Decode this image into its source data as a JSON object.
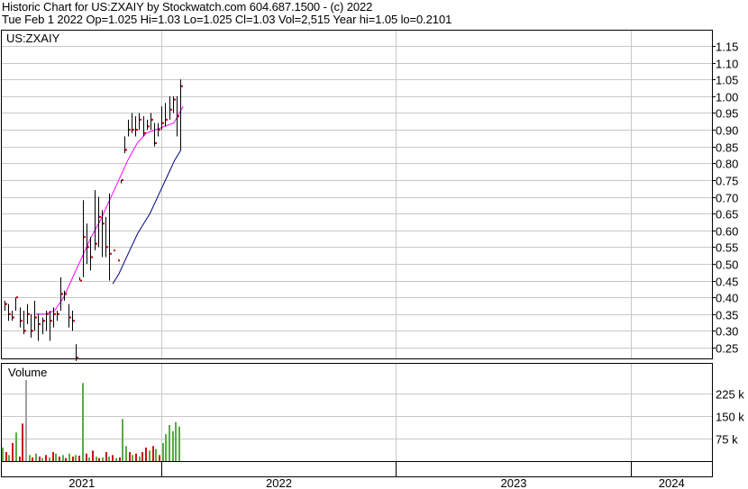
{
  "header": {
    "title": "Historic Chart for US:ZXAIY by Stockwatch.com 604.687.1500 - (c) 2022",
    "quote": "Tue Feb  1 2022  Op=1.025  Hi=1.03  Lo=1.025  Cl=1.03  Vol=2,515  Year hi=1.05  lo=0.2101"
  },
  "chart_data": [
    {
      "type": "ohlc",
      "title": "US:ZXAIY",
      "yticks": [
        "1.15",
        "1.10",
        "1.05",
        "1.00",
        "0.95",
        "0.90",
        "0.85",
        "0.80",
        "0.75",
        "0.70",
        "0.65",
        "0.60",
        "0.55",
        "0.50",
        "0.45",
        "0.40",
        "0.35",
        "0.30",
        "0.25"
      ],
      "ylim": [
        0.2,
        1.18
      ],
      "grid": true,
      "x_axis_labels": [
        "2021",
        "2022",
        "2023",
        "2024"
      ],
      "series": [
        {
          "style": "bars",
          "values": [
            {
              "h": 0.39,
              "l": 0.36,
              "c": 0.38
            },
            {
              "h": 0.38,
              "l": 0.33,
              "c": 0.35
            },
            {
              "h": 0.36,
              "l": 0.33,
              "c": 0.34
            },
            {
              "h": 0.4,
              "l": 0.36,
              "c": 0.4
            },
            {
              "h": 0.37,
              "l": 0.31,
              "c": 0.33
            },
            {
              "h": 0.36,
              "l": 0.29,
              "c": 0.3
            },
            {
              "h": 0.38,
              "l": 0.32,
              "c": 0.35
            },
            {
              "h": 0.35,
              "l": 0.28,
              "c": 0.3
            },
            {
              "h": 0.39,
              "l": 0.3,
              "c": 0.34
            },
            {
              "h": 0.35,
              "l": 0.27,
              "c": 0.32
            },
            {
              "h": 0.34,
              "l": 0.29,
              "c": 0.33
            },
            {
              "h": 0.36,
              "l": 0.3,
              "c": 0.35
            },
            {
              "h": 0.36,
              "l": 0.27,
              "c": 0.33
            },
            {
              "h": 0.37,
              "l": 0.31,
              "c": 0.35
            },
            {
              "h": 0.36,
              "l": 0.33,
              "c": 0.35
            },
            {
              "h": 0.46,
              "l": 0.36,
              "c": 0.41
            },
            {
              "h": 0.42,
              "l": 0.39,
              "c": 0.41
            },
            {
              "h": 0.38,
              "l": 0.31,
              "c": 0.34
            },
            {
              "h": 0.36,
              "l": 0.3,
              "c": 0.33
            },
            {
              "h": 0.26,
              "l": 0.21,
              "c": 0.22
            },
            {
              "h": 0.46,
              "l": 0.45,
              "c": 0.45
            },
            {
              "h": 0.69,
              "l": 0.46,
              "c": 0.58
            },
            {
              "h": 0.62,
              "l": 0.5,
              "c": 0.55
            },
            {
              "h": 0.58,
              "l": 0.48,
              "c": 0.52
            },
            {
              "h": 0.72,
              "l": 0.54,
              "c": 0.56
            },
            {
              "h": 0.7,
              "l": 0.55,
              "c": 0.64
            },
            {
              "h": 0.66,
              "l": 0.52,
              "c": 0.62
            },
            {
              "h": 0.64,
              "l": 0.52,
              "c": 0.55
            },
            {
              "h": 0.71,
              "l": 0.45,
              "c": 0.53
            },
            {
              "h": 0.54,
              "l": 0.54,
              "c": 0.54
            },
            {
              "h": 0.51,
              "l": 0.51,
              "c": 0.51
            },
            {
              "h": 0.75,
              "l": 0.74,
              "c": 0.75
            },
            {
              "h": 0.88,
              "l": 0.83,
              "c": 0.84
            },
            {
              "h": 0.93,
              "l": 0.88,
              "c": 0.9
            },
            {
              "h": 0.95,
              "l": 0.89,
              "c": 0.9
            },
            {
              "h": 0.94,
              "l": 0.88,
              "c": 0.9
            },
            {
              "h": 0.95,
              "l": 0.9,
              "c": 0.93
            },
            {
              "h": 0.94,
              "l": 0.88,
              "c": 0.89
            },
            {
              "h": 0.93,
              "l": 0.9,
              "c": 0.91
            },
            {
              "h": 0.95,
              "l": 0.9,
              "c": 0.93
            },
            {
              "h": 0.92,
              "l": 0.85,
              "c": 0.86
            },
            {
              "h": 0.92,
              "l": 0.88,
              "c": 0.9
            },
            {
              "h": 0.97,
              "l": 0.9,
              "c": 0.92
            },
            {
              "h": 0.98,
              "l": 0.91,
              "c": 0.93
            },
            {
              "h": 1.0,
              "l": 0.93,
              "c": 0.96
            },
            {
              "h": 1.0,
              "l": 0.95,
              "c": 0.99
            },
            {
              "h": 1.0,
              "l": 0.88,
              "c": 0.94
            },
            {
              "h": 1.05,
              "l": 0.84,
              "c": 1.03
            }
          ]
        },
        {
          "style": "moving-average",
          "color": "#ff00ff",
          "values": [
            0.35,
            0.35,
            0.36,
            0.4,
            0.46,
            0.52,
            0.58,
            0.63,
            0.69,
            0.75,
            0.81,
            0.86,
            0.89,
            0.9,
            0.91,
            0.92,
            0.97
          ]
        },
        {
          "style": "moving-average",
          "color": "#000080",
          "values": [
            0.44,
            0.47,
            0.51,
            0.55,
            0.59,
            0.62,
            0.65,
            0.69,
            0.73,
            0.77,
            0.81,
            0.84
          ]
        }
      ]
    },
    {
      "type": "bar",
      "title": "Volume",
      "yticks": [
        "225 k",
        "150 k",
        "75 k"
      ],
      "ylim": [
        0,
        300000
      ],
      "series": [
        {
          "name": "",
          "values": [
            {
              "v": 45000,
              "c": "g"
            },
            {
              "v": 30000,
              "c": "r"
            },
            {
              "v": 20000,
              "c": "g"
            },
            {
              "v": 60000,
              "c": "r"
            },
            {
              "v": 95000,
              "c": "g"
            },
            {
              "v": 15000,
              "c": "r"
            },
            {
              "v": 125000,
              "c": "r"
            },
            {
              "v": 270000,
              "c": "x"
            },
            {
              "v": 20000,
              "c": "g"
            },
            {
              "v": 12000,
              "c": "r"
            },
            {
              "v": 25000,
              "c": "g"
            },
            {
              "v": 15000,
              "c": "r"
            },
            {
              "v": 10000,
              "c": "g"
            },
            {
              "v": 20000,
              "c": "r"
            },
            {
              "v": 12000,
              "c": "g"
            },
            {
              "v": 30000,
              "c": "r"
            },
            {
              "v": 25000,
              "c": "g"
            },
            {
              "v": 15000,
              "c": "r"
            },
            {
              "v": 20000,
              "c": "g"
            },
            {
              "v": 10000,
              "c": "r"
            },
            {
              "v": 25000,
              "c": "g"
            },
            {
              "v": 15000,
              "c": "r"
            },
            {
              "v": 20000,
              "c": "g"
            },
            {
              "v": 18000,
              "c": "r"
            },
            {
              "v": 260000,
              "c": "g"
            },
            {
              "v": 25000,
              "c": "r"
            },
            {
              "v": 12000,
              "c": "g"
            },
            {
              "v": 35000,
              "c": "r"
            },
            {
              "v": 15000,
              "c": "g"
            },
            {
              "v": 10000,
              "c": "r"
            },
            {
              "v": 12000,
              "c": "g"
            },
            {
              "v": 30000,
              "c": "r"
            },
            {
              "v": 15000,
              "c": "g"
            },
            {
              "v": 20000,
              "c": "r"
            },
            {
              "v": 10000,
              "c": "g"
            },
            {
              "v": 12000,
              "c": "r"
            },
            {
              "v": 140000,
              "c": "g"
            },
            {
              "v": 50000,
              "c": "g"
            },
            {
              "v": 30000,
              "c": "r"
            },
            {
              "v": 20000,
              "c": "g"
            },
            {
              "v": 25000,
              "c": "r"
            },
            {
              "v": 15000,
              "c": "g"
            },
            {
              "v": 30000,
              "c": "r"
            },
            {
              "v": 45000,
              "c": "r"
            },
            {
              "v": 35000,
              "c": "g"
            },
            {
              "v": 50000,
              "c": "r"
            },
            {
              "v": 40000,
              "c": "g"
            },
            {
              "v": 20000,
              "c": "r"
            },
            {
              "v": 60000,
              "c": "g"
            },
            {
              "v": 90000,
              "c": "g"
            },
            {
              "v": 120000,
              "c": "g"
            },
            {
              "v": 100000,
              "c": "g"
            },
            {
              "v": 130000,
              "c": "g"
            },
            {
              "v": 115000,
              "c": "g"
            }
          ]
        }
      ]
    }
  ],
  "colors": {
    "grid": "#c8c8c8",
    "bar": "#000000",
    "close_tick": "#cc0000",
    "vol_up": "#5aaa46",
    "vol_down": "#cc1111",
    "vol_other": "#a0a0a0"
  }
}
